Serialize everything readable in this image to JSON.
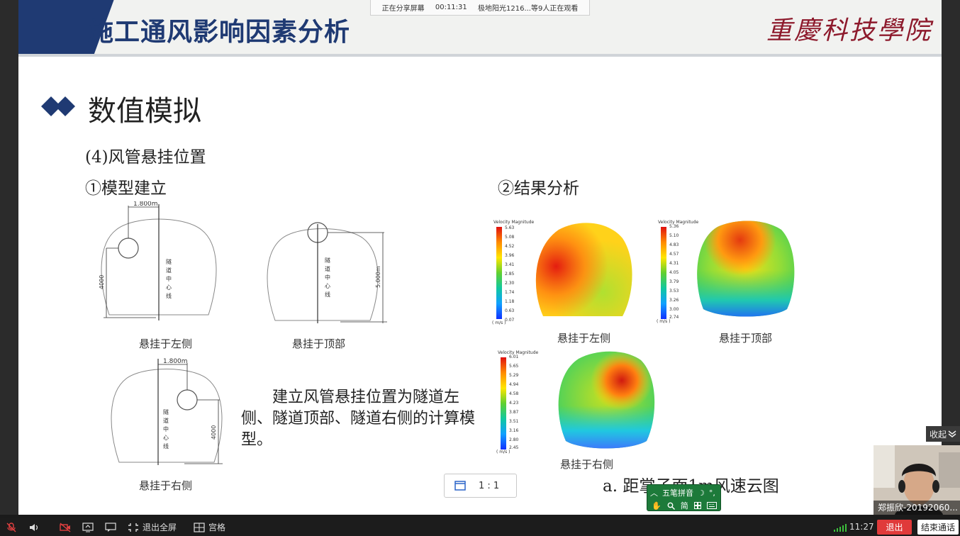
{
  "slide": {
    "title": "施工通风影响因素分析",
    "school_logo": "重慶科技學院",
    "section_title": "数值模拟",
    "subsection_title": "(4)风管悬挂位置",
    "model_label": "①模型建立",
    "result_label": "②结果分析",
    "diagrams": {
      "left": {
        "caption": "悬挂于左侧",
        "width_dim": "1.800m",
        "height_dim": "4000",
        "centerline": [
          "隧",
          "道",
          "中",
          "心",
          "线"
        ]
      },
      "top": {
        "caption": "悬挂于顶部",
        "height_dim": "5.000m",
        "centerline": [
          "隧",
          "道",
          "中",
          "心",
          "线"
        ]
      },
      "right": {
        "caption": "悬挂于右侧",
        "width_dim": "1.800m",
        "height_dim": "4000",
        "centerline": [
          "隧",
          "道",
          "中",
          "心",
          "线"
        ]
      }
    },
    "description": "建立风管悬挂位置为隧道左侧、隧道顶部、隧道右侧的计算模型。",
    "results": {
      "left": {
        "caption": "悬挂于左侧",
        "legend_title": "Velocity Magnitude",
        "unit": "( m/s )",
        "ticks": [
          "5.63",
          "5.08",
          "4.52",
          "3.96",
          "3.41",
          "2.85",
          "2.30",
          "1.74",
          "1.18",
          "0.63",
          "0.07"
        ]
      },
      "top": {
        "caption": "悬挂于顶部",
        "legend_title": "Velocity Magnitude",
        "unit": "( m/s )",
        "ticks": [
          "5.36",
          "5.10",
          "4.83",
          "4.57",
          "4.31",
          "4.05",
          "3.79",
          "3.53",
          "3.26",
          "3.00",
          "2.74"
        ]
      },
      "right": {
        "caption": "悬挂于右侧",
        "legend_title": "Velocity Magnitude",
        "unit": "( m/s )",
        "ticks": [
          "6.01",
          "5.65",
          "5.29",
          "4.94",
          "4.58",
          "4.23",
          "3.87",
          "3.51",
          "3.16",
          "2.80",
          "2.45"
        ]
      }
    },
    "figure_caption": "a. 距掌子面1m风速云图"
  },
  "meeting": {
    "share_status": "正在分享屏幕",
    "share_time": "00:11:31",
    "viewers": "极地阳光1216...等9人正在观看",
    "collapse_label": "收起",
    "participant_name": "郑振欣-20192060...",
    "zoom_ratio": "1 : 1"
  },
  "ime": {
    "name": "五笔拼音",
    "moon": "☽",
    "punct": "°,",
    "simplified": "简"
  },
  "taskbar": {
    "exit_fullscreen": "退出全屏",
    "grid": "宫格",
    "clock": "11:27",
    "exit": "退出",
    "end_call": "结束通话"
  }
}
